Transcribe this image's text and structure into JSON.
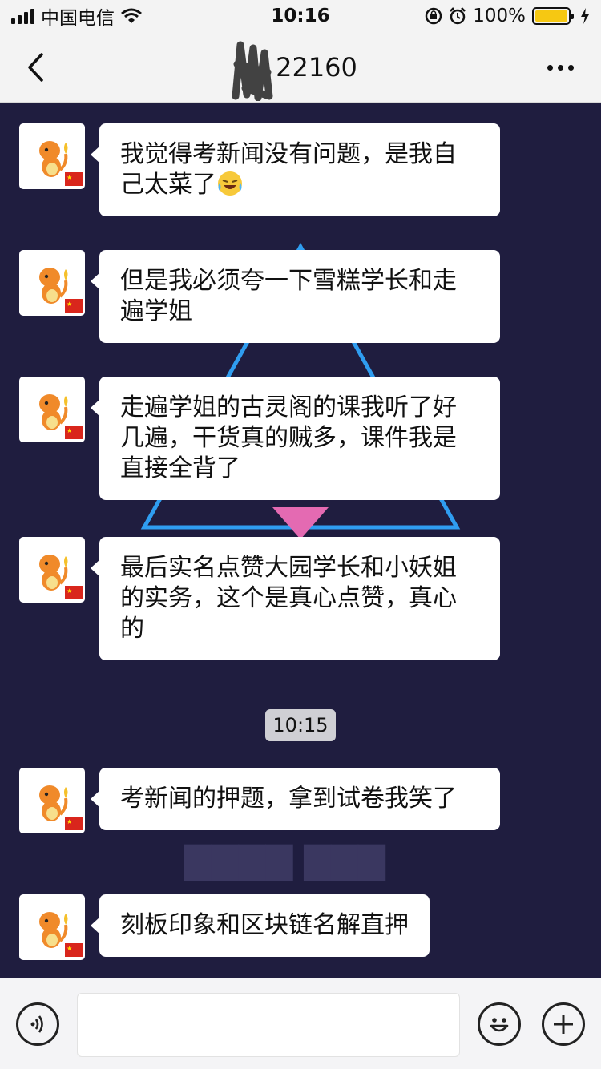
{
  "status_bar": {
    "carrier": "中国电信",
    "time": "10:16",
    "battery_percent": "100%",
    "battery_level": 1.0,
    "battery_color": "#f6c812",
    "icons": [
      "signal-icon",
      "wifi-icon",
      "rotation-lock-icon",
      "alarm-icon",
      "battery-icon",
      "charging-icon"
    ]
  },
  "nav": {
    "title": "22160",
    "back_icon": "chevron-left-icon",
    "more_icon": "more-icon"
  },
  "chat": {
    "background_color": "#1f1d3f",
    "time_divider": "10:15",
    "messages_before": [
      {
        "text": "我觉得考新闻没有问题，是我自己太菜了",
        "emoji": "crying-laughing-emoji"
      },
      {
        "text": "但是我必须夸一下雪糕学长和走遍学姐"
      },
      {
        "text": "走遍学姐的古灵阁的课我听了好几遍，干货真的贼多，课件我是直接全背了"
      },
      {
        "text": "最后实名点赞大园学长和小妖姐的实务，这个是真心点赞，真心的"
      }
    ],
    "messages_after": [
      {
        "text": "考新闻的押题，拿到试卷我笑了"
      },
      {
        "text": "刻板印象和区块链名解直押"
      }
    ]
  },
  "input_bar": {
    "placeholder": "",
    "voice_icon": "voice-icon",
    "emoji_icon": "emoji-icon",
    "plus_icon": "plus-icon"
  }
}
